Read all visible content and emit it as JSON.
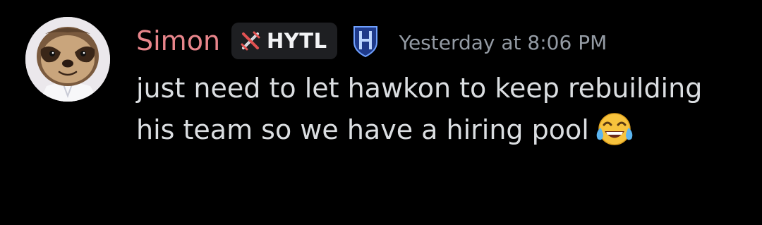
{
  "message": {
    "author": {
      "name": "Simon",
      "name_color": "#e8858b",
      "avatar": "sloth-avatar"
    },
    "guild_tag": {
      "icon": "sword-icon",
      "text": "HYTL"
    },
    "role_icon": "hytale-shield-icon",
    "timestamp": "Yesterday at 8:06 PM",
    "content": "just need to let hawkon to keep rebuilding his team so we have a hiring pool",
    "emoji": "face-with-tears-of-joy"
  }
}
